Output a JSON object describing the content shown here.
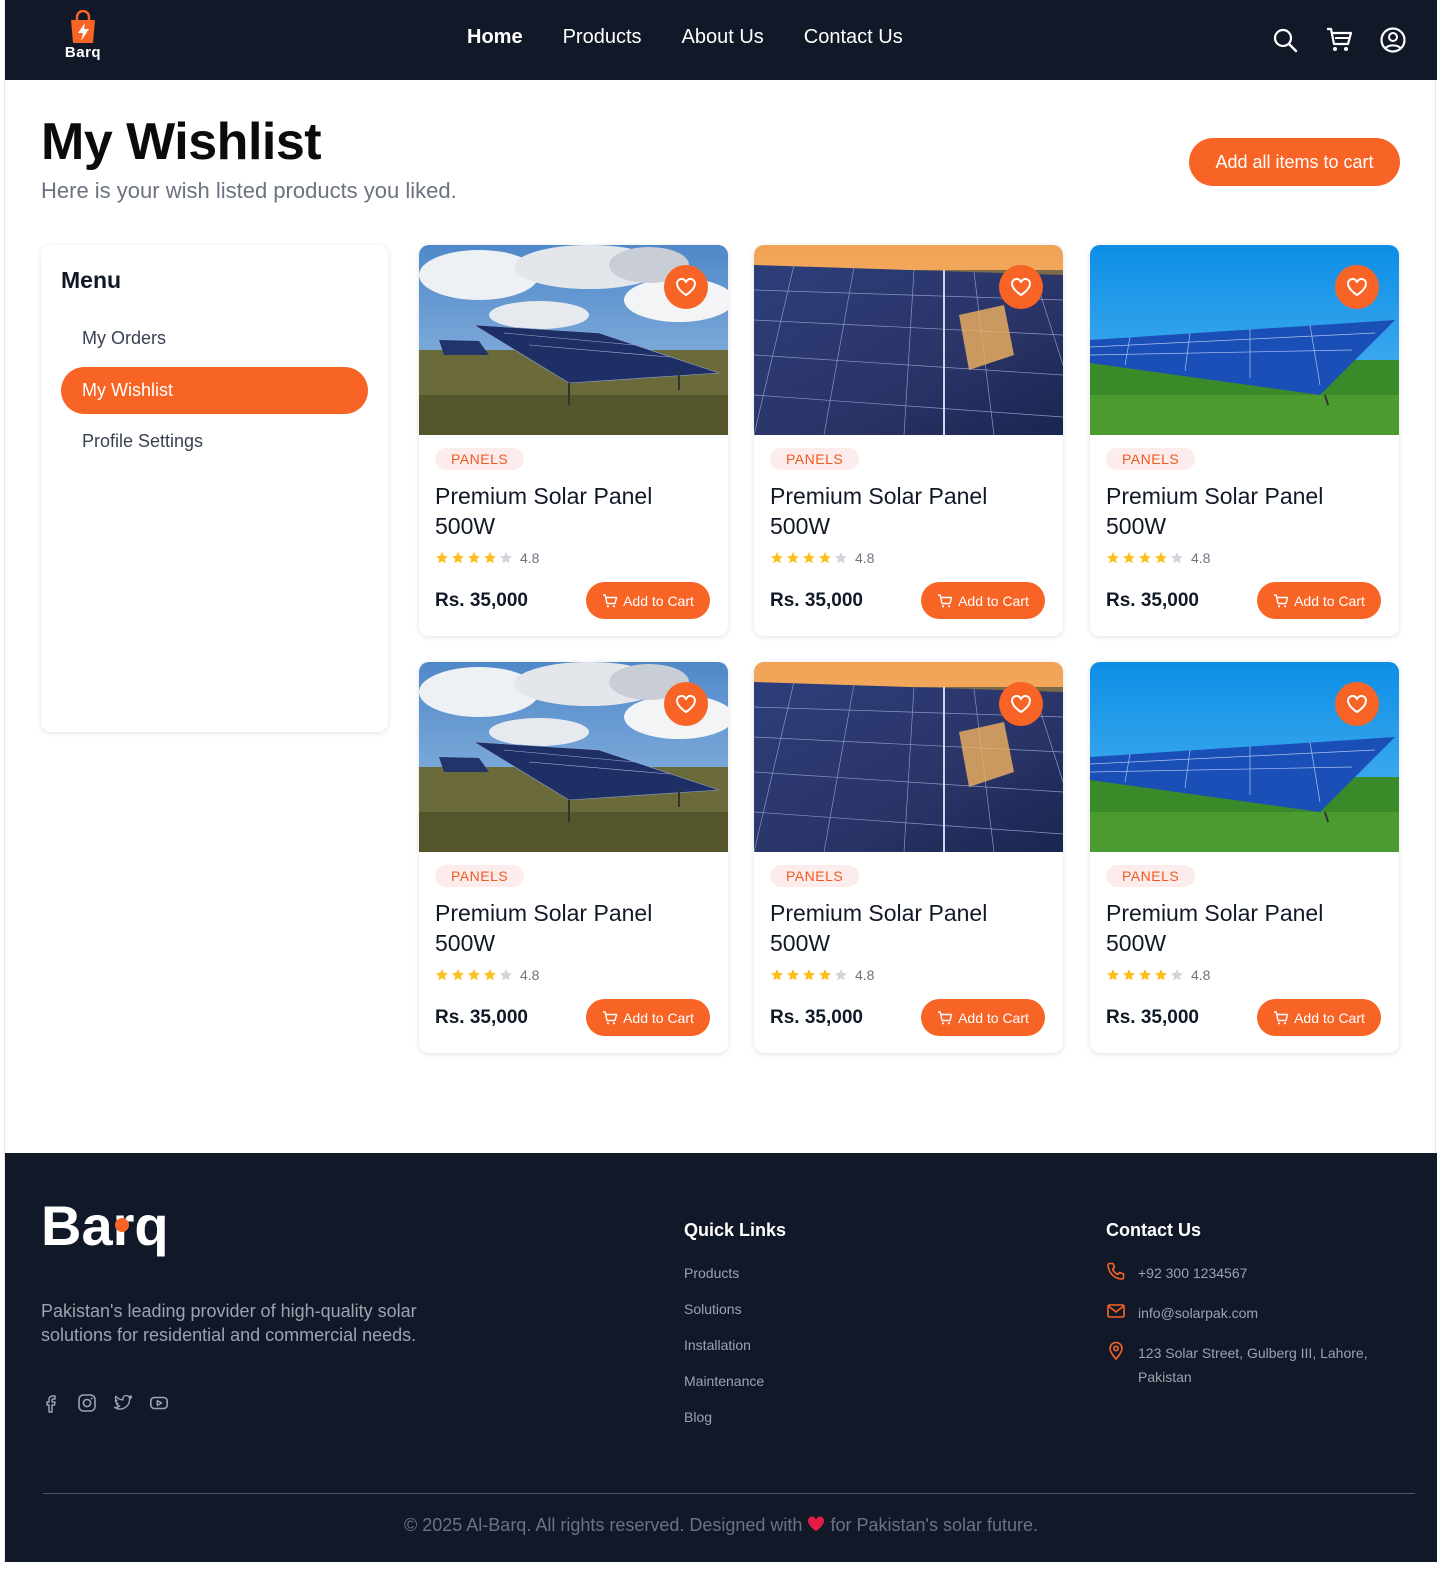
{
  "brand": {
    "name": "Barq",
    "accent": "#f86425",
    "dark": "#111827"
  },
  "nav": {
    "links": [
      "Home",
      "Products",
      "About Us",
      "Contact Us"
    ],
    "active": "Home",
    "icons": [
      "search-icon",
      "cart-icon",
      "user-circle-icon"
    ]
  },
  "page": {
    "title": "My Wishlist",
    "subtitle": "Here is your wish listed products you liked.",
    "add_all_label": "Add all items to cart"
  },
  "sidebar": {
    "title": "Menu",
    "items": [
      {
        "label": "My Orders",
        "active": false
      },
      {
        "label": "My Wishlist",
        "active": true
      },
      {
        "label": "Profile Settings",
        "active": false
      }
    ]
  },
  "products": [
    {
      "category": "PANELS",
      "title": "Premium Solar Panel 500W",
      "rating": "4.8",
      "stars": 4,
      "price": "Rs. 35,000",
      "cart_label": "Add to Cart",
      "image": "cloudy-field"
    },
    {
      "category": "PANELS",
      "title": "Premium Solar Panel 500W",
      "rating": "4.8",
      "stars": 4,
      "price": "Rs. 35,000",
      "cart_label": "Add to Cart",
      "image": "sunset-closeup"
    },
    {
      "category": "PANELS",
      "title": "Premium Solar Panel 500W",
      "rating": "4.8",
      "stars": 4,
      "price": "Rs. 35,000",
      "cart_label": "Add to Cart",
      "image": "blue-sky"
    },
    {
      "category": "PANELS",
      "title": "Premium Solar Panel 500W",
      "rating": "4.8",
      "stars": 4,
      "price": "Rs. 35,000",
      "cart_label": "Add to Cart",
      "image": "cloudy-field"
    },
    {
      "category": "PANELS",
      "title": "Premium Solar Panel 500W",
      "rating": "4.8",
      "stars": 4,
      "price": "Rs. 35,000",
      "cart_label": "Add to Cart",
      "image": "sunset-closeup"
    },
    {
      "category": "PANELS",
      "title": "Premium Solar Panel 500W",
      "rating": "4.8",
      "stars": 4,
      "price": "Rs. 35,000",
      "cart_label": "Add to Cart",
      "image": "blue-sky"
    }
  ],
  "footer": {
    "description": "Pakistan's leading provider of high-quality solar solutions for residential and commercial needs.",
    "social_icons": [
      "facebook-icon",
      "instagram-icon",
      "twitter-icon",
      "youtube-icon"
    ],
    "quick_links_title": "Quick Links",
    "quick_links": [
      "Products",
      "Solutions",
      "Installation",
      "Maintenance",
      "Blog"
    ],
    "contact_title": "Contact Us",
    "phone": "+92 300 1234567",
    "email": "info@solarpak.com",
    "address": "123 Solar Street, Gulberg III, Lahore, Pakistan",
    "copyright_before": "© 2025 Al-Barq. All rights reserved. Designed with",
    "copyright_after": "for Pakistan's solar future."
  }
}
